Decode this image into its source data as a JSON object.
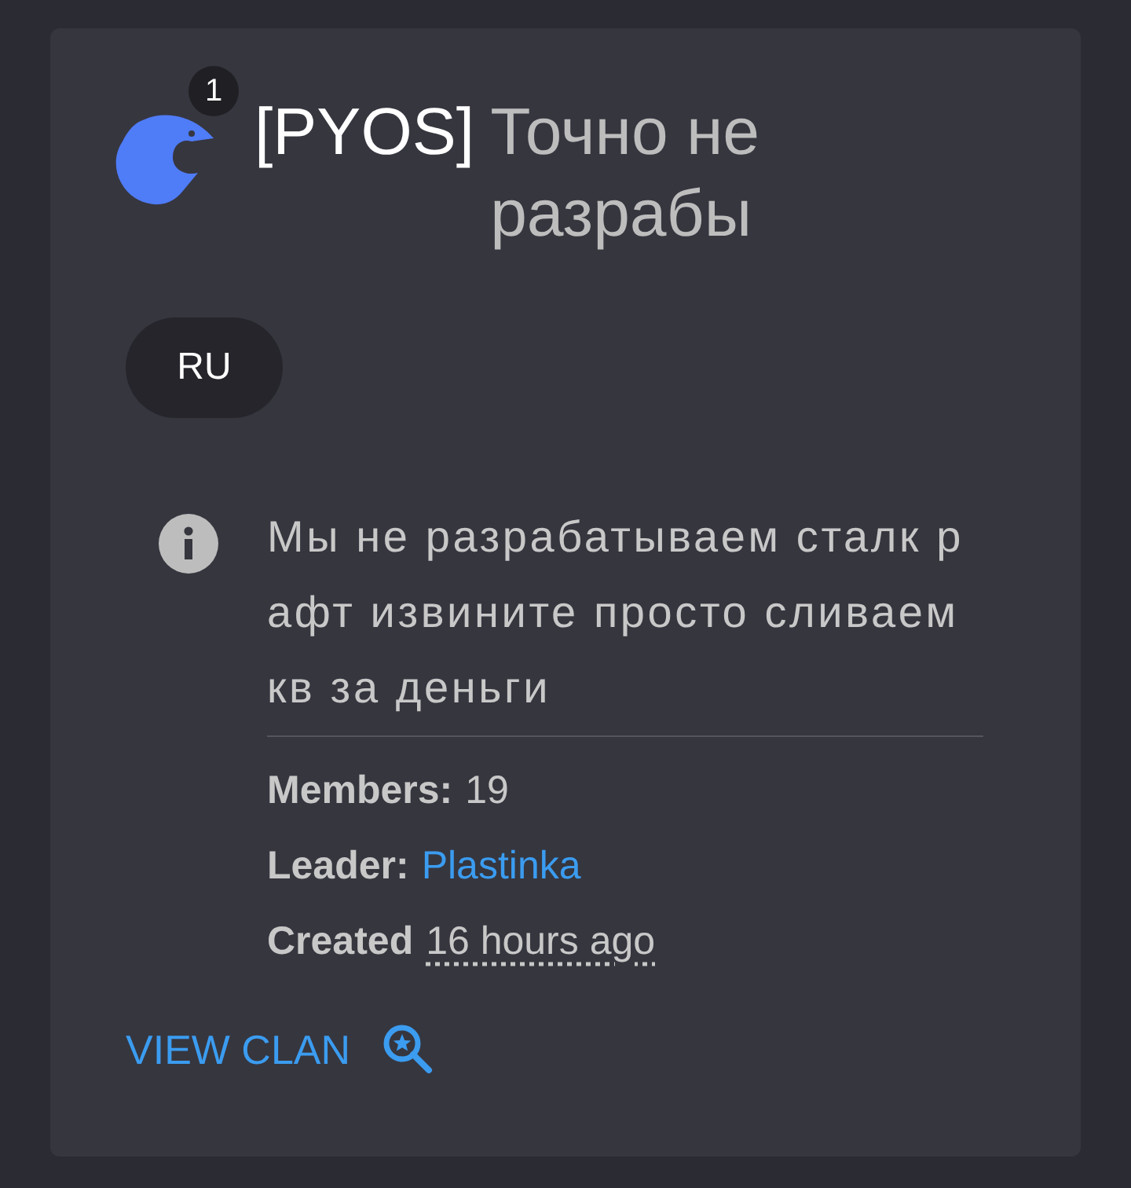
{
  "clan": {
    "tag": "[PYOS]",
    "name": "Точно не разрабы",
    "badge": "1",
    "language": "RU",
    "description": "Мы не разрабатываем сталк рафт извините просто сливаем кв за деньги",
    "stats": [
      {
        "kind": "plain",
        "label": "Members:",
        "value": "19"
      },
      {
        "kind": "link",
        "label": "Leader:",
        "value": "Plastinka"
      },
      {
        "kind": "time",
        "label": "Created",
        "value": "16 hours ago"
      }
    ],
    "action": "VIEW CLAN"
  }
}
